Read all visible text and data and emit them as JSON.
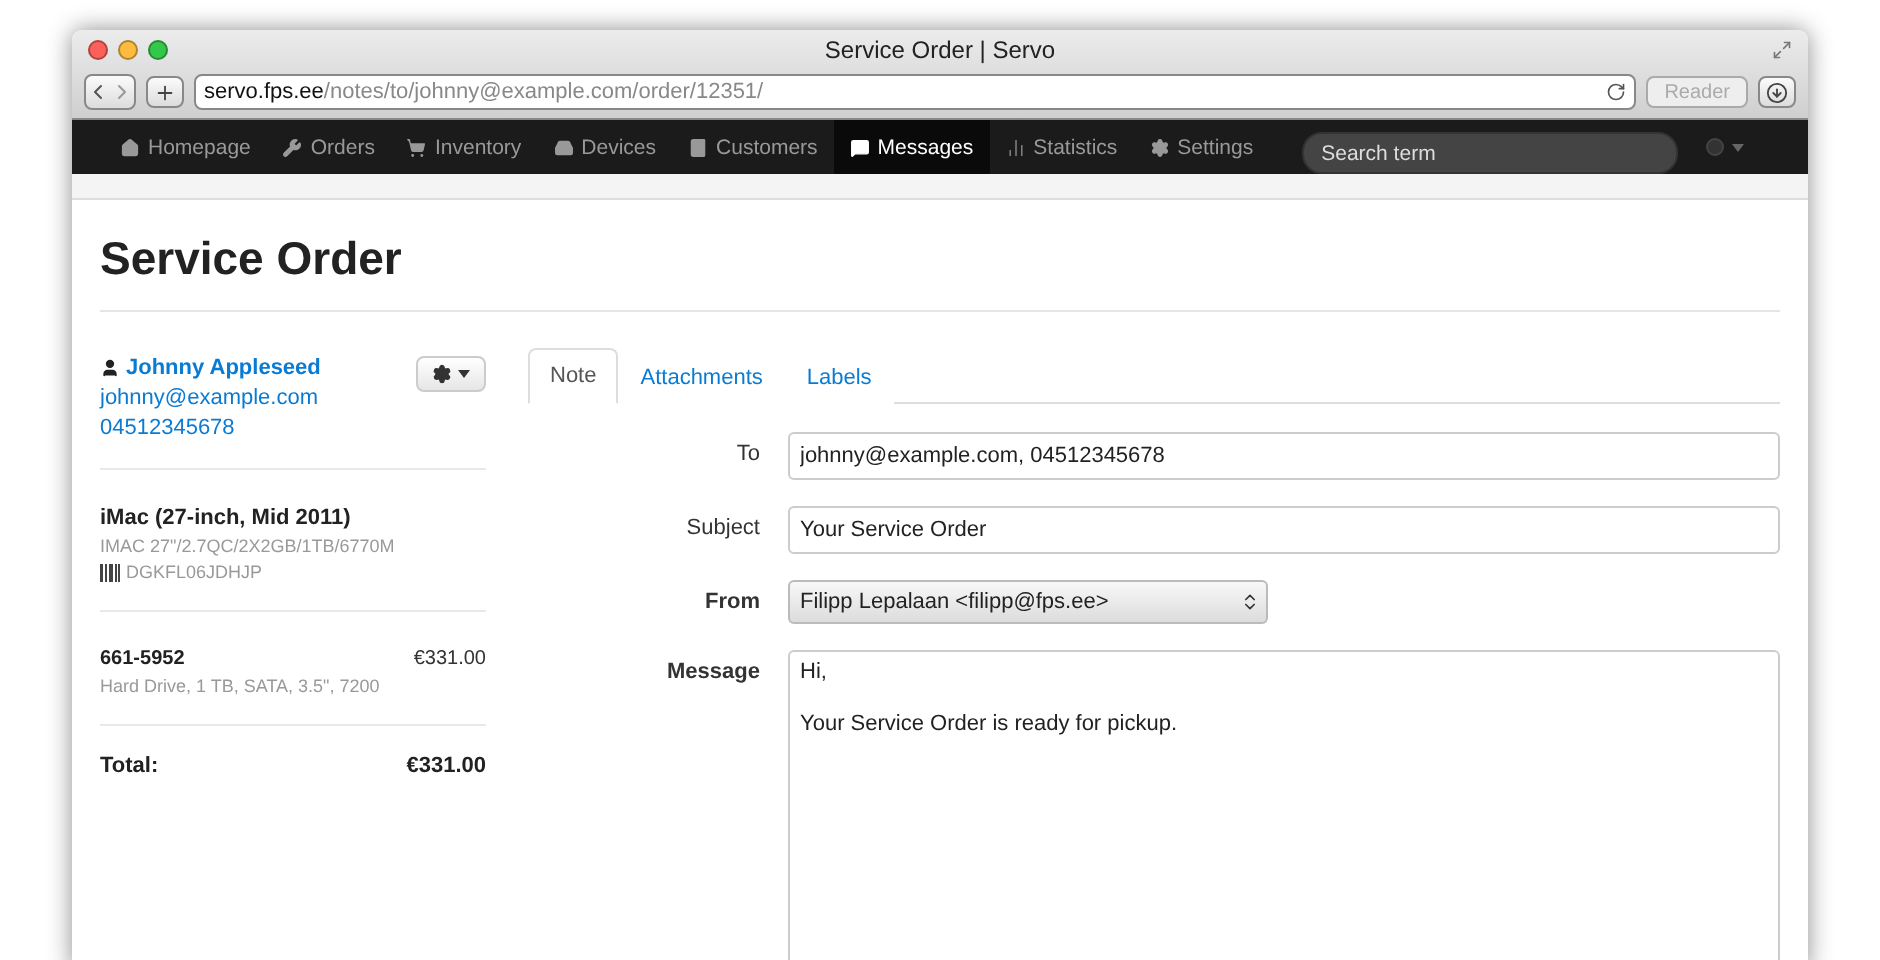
{
  "window": {
    "title": "Service Order | Servo"
  },
  "address": {
    "host": "servo.fps.ee",
    "path": "/notes/to/johnny@example.com/order/12351/"
  },
  "reader": "Reader",
  "nav": [
    {
      "label": "Homepage",
      "selected": false
    },
    {
      "label": "Orders",
      "selected": false
    },
    {
      "label": "Inventory",
      "selected": false
    },
    {
      "label": "Devices",
      "selected": false
    },
    {
      "label": "Customers",
      "selected": false
    },
    {
      "label": "Messages",
      "selected": true
    },
    {
      "label": "Statistics",
      "selected": false
    },
    {
      "label": "Settings",
      "selected": false
    }
  ],
  "search": {
    "placeholder": "Search term"
  },
  "page_title": "Service Order",
  "customer": {
    "name": "Johnny Appleseed",
    "email": "johnny@example.com",
    "phone": "04512345678"
  },
  "device": {
    "name": "iMac (27-inch, Mid 2011)",
    "config": "IMAC 27\"/2.7QC/2X2GB/1TB/6770M",
    "serial": "DGKFL06JDHJP"
  },
  "part": {
    "code": "661-5952",
    "price": "€331.00",
    "description": "Hard Drive, 1 TB, SATA, 3.5\", 7200"
  },
  "total": {
    "label": "Total:",
    "value": "€331.00"
  },
  "tabs": [
    {
      "label": "Note",
      "selected": true
    },
    {
      "label": "Attachments",
      "selected": false
    },
    {
      "label": "Labels",
      "selected": false
    }
  ],
  "fields": [
    {
      "label": "To",
      "kind": "input",
      "bold": false,
      "value": "johnny@example.com, 04512345678"
    },
    {
      "label": "Subject",
      "kind": "input",
      "bold": false,
      "value": "Your Service Order"
    },
    {
      "label": "From",
      "kind": "select",
      "bold": true,
      "value": "Filipp Lepalaan <filipp@fps.ee>"
    },
    {
      "label": "Message",
      "kind": "textarea",
      "bold": true,
      "lines": [
        "Hi,",
        "Your Service Order is ready for pickup."
      ]
    }
  ]
}
